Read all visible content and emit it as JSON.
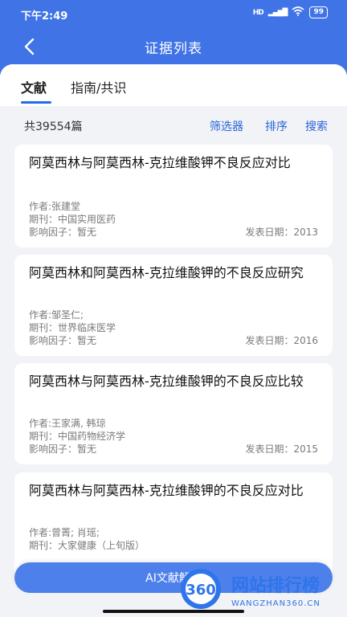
{
  "status": {
    "time": "下午2:49",
    "signal": "HD",
    "battery": "99"
  },
  "header": {
    "title": "证据列表"
  },
  "tabs": [
    {
      "label": "文献",
      "active": true
    },
    {
      "label": "指南/共识",
      "active": false
    }
  ],
  "toolbar": {
    "total": "共39554篇",
    "filter": "筛选器",
    "sort": "排序",
    "search": "搜索"
  },
  "cards": [
    {
      "title": "阿莫西林与阿莫西林-克拉维酸钾不良反应对比",
      "author": "作者:张建堂",
      "journal": "期刊：中国实用医药",
      "impact": "影响因子：暂无",
      "date": "发表日期：2013"
    },
    {
      "title": "阿莫西林和阿莫西林-克拉维酸钾的不良反应研究",
      "author": "作者:邹圣仁;",
      "journal": "期刊：世界临床医学",
      "impact": "影响因子：暂无",
      "date": "发表日期：2016"
    },
    {
      "title": "阿莫西林与阿莫西林-克拉维酸钾的不良反应比较",
      "author": "作者:王家满, 韩琼",
      "journal": "期刊：中国药物经济学",
      "impact": "影响因子：暂无",
      "date": "发表日期：2015"
    },
    {
      "title": "阿莫西林与阿莫西林-克拉维酸钾的不良反应对比",
      "author": "作者:曾菁; 肖瑶;",
      "journal": "期刊：大家健康（上旬版）",
      "impact": "",
      "date": ""
    }
  ],
  "ai_button": {
    "label": "AI文献解读"
  },
  "watermark": {
    "number": "360",
    "name": "网站排行榜",
    "url": "WANGZHAN360.CN"
  },
  "colors": {
    "brand": "#3f73e6",
    "link": "#2a66d9",
    "tab_underline": "#1f6ee8"
  }
}
